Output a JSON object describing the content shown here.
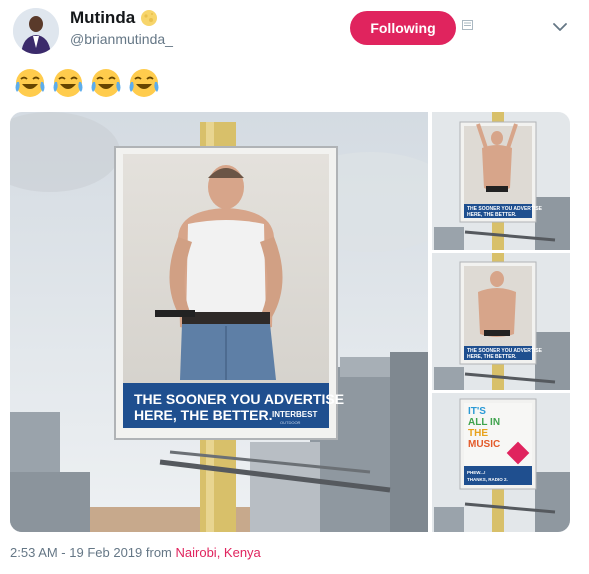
{
  "author": {
    "display_name": "Mutinda",
    "handle": "@brianmutinda_",
    "name_emoji": "full-moon-emoji"
  },
  "actions": {
    "follow_label": "Following",
    "block_icon": "block-icon",
    "menu_icon": "chevron-down-icon"
  },
  "tweet": {
    "emojis": [
      "tears-of-joy-emoji",
      "tears-of-joy-emoji",
      "tears-of-joy-emoji",
      "tears-of-joy-emoji"
    ]
  },
  "media": {
    "main_billboard": {
      "headline_line1": "THE SOONER YOU ADVERTISE",
      "headline_line2": "HERE, THE BETTER.",
      "brand": "INTERBEST",
      "brand_sub": "OUTDOOR"
    },
    "thumb1": {
      "headline_line1": "THE SOONER YOU ADVERTISE",
      "headline_line2": "HERE, THE BETTER."
    },
    "thumb2": {
      "headline_line1": "THE SOONER YOU ADVERTISE",
      "headline_line2": "HERE, THE BETTER."
    },
    "thumb3": {
      "line1": "IT'S",
      "line2": "ALL IN",
      "line3": "THE",
      "line4": "MUSIC",
      "small1": "PHEW...!",
      "small2": "THANKS, RADIO 2."
    }
  },
  "footer": {
    "time_date": "2:53 AM - 19 Feb 2019",
    "from_word": "from",
    "location": "Nairobi, Kenya"
  },
  "colors": {
    "accent": "#e0245e",
    "text": "#14171a",
    "muted": "#657786",
    "billboard_band": "#1f4f8f"
  }
}
